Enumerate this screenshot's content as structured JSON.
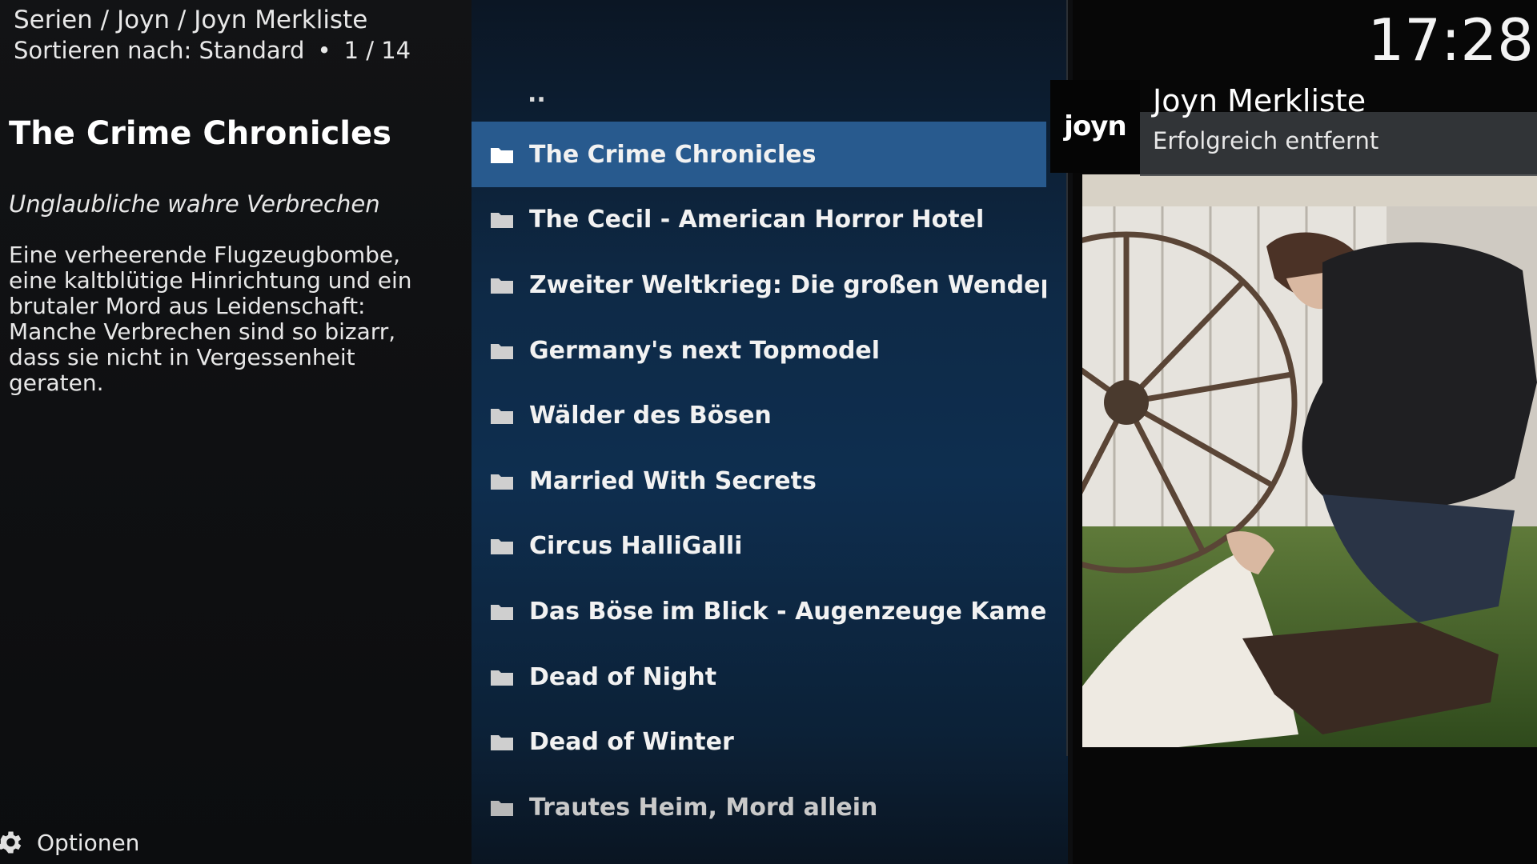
{
  "header": {
    "breadcrumb": "Serien / Joyn / Joyn Merkliste",
    "sort_label": "Sortieren nach: Standard",
    "position": "1 / 14",
    "clock": "17:28"
  },
  "info": {
    "title": "The Crime Chronicles",
    "tagline": "Unglaubliche wahre Verbrechen",
    "plot": "Eine verheerende Flugzeugbombe, eine kaltblütige Hinrichtung und ein brutaler Mord aus Leidenschaft: Manche Verbrechen sind so bizarr, dass sie nicht in Vergessenheit geraten."
  },
  "list": {
    "parent_label": "..",
    "items": [
      {
        "label": "The Crime Chronicles",
        "icon": "folder-icon",
        "selected": true
      },
      {
        "label": "The Cecil - American Horror Hotel",
        "icon": "folder-icon"
      },
      {
        "label": "Zweiter Weltkrieg: Die großen Wendep...",
        "icon": "folder-icon"
      },
      {
        "label": "Germany's next Topmodel",
        "icon": "folder-icon"
      },
      {
        "label": "Wälder des Bösen",
        "icon": "folder-icon"
      },
      {
        "label": "Married With Secrets",
        "icon": "folder-icon"
      },
      {
        "label": "Circus HalliGalli",
        "icon": "folder-icon"
      },
      {
        "label": "Das Böse im Blick - Augenzeuge Kamera",
        "icon": "folder-icon"
      },
      {
        "label": "Dead of Night",
        "icon": "folder-icon"
      },
      {
        "label": "Dead of Winter",
        "icon": "folder-icon"
      },
      {
        "label": "Trautes Heim, Mord allein",
        "icon": "folder-icon"
      }
    ]
  },
  "notification": {
    "logo_text": "joyn",
    "title": "Joyn Merkliste",
    "message": "Erfolgreich entfernt"
  },
  "footer": {
    "options_label": "Optionen",
    "options_icon": "gear-icon"
  },
  "colors": {
    "selected_row": "#285a8e",
    "list_bg": "#0e2e4f",
    "sidebar_bg": "#121315"
  }
}
